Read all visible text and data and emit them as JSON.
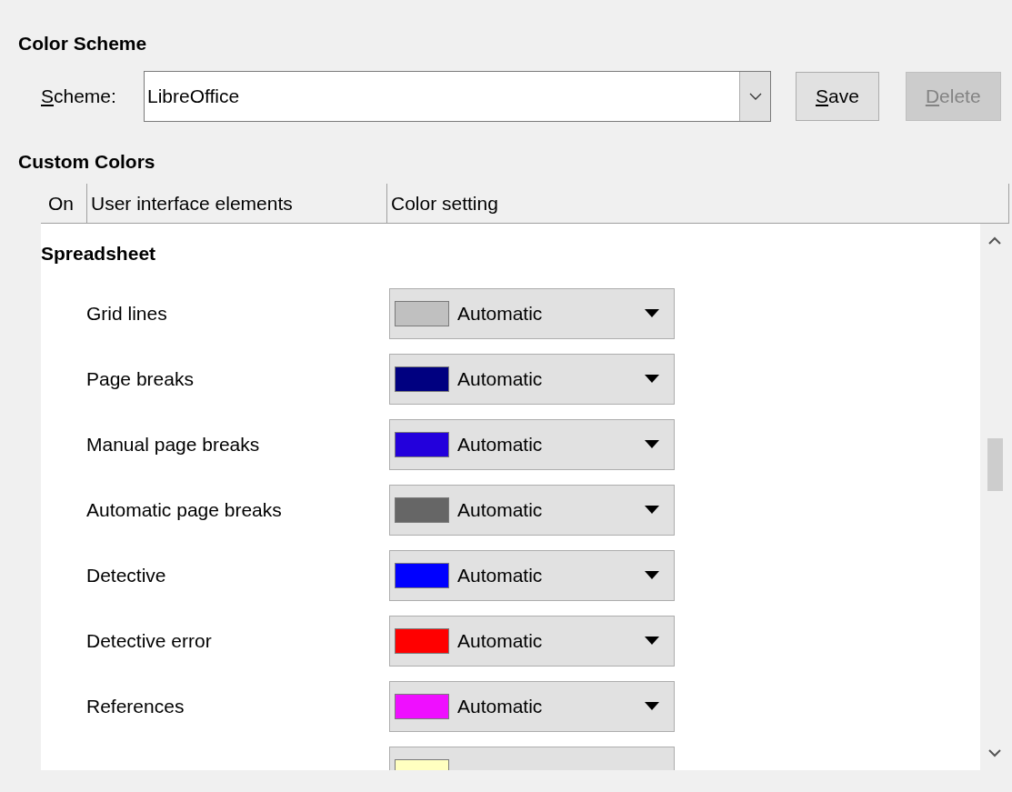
{
  "color_scheme": {
    "title": "Color Scheme",
    "label": {
      "text": "Scheme:",
      "access_key_underlined": true
    },
    "value": "LibreOffice",
    "buttons": [
      {
        "label": "Save",
        "disabled": false,
        "access_key_underlined": true
      },
      {
        "label": "Delete",
        "disabled": true,
        "access_key_underlined": true
      }
    ]
  },
  "custom_colors": {
    "title": "Custom Colors",
    "columns": [
      "On",
      "User interface elements",
      "Color setting"
    ],
    "section": "Spreadsheet",
    "rows": [
      {
        "label": "Grid lines",
        "color": "#c0c0c0",
        "setting": "Automatic"
      },
      {
        "label": "Page breaks",
        "color": "#000080",
        "setting": "Automatic"
      },
      {
        "label": "Manual page breaks",
        "color": "#2300dc",
        "setting": "Automatic"
      },
      {
        "label": "Automatic page breaks",
        "color": "#666666",
        "setting": "Automatic"
      },
      {
        "label": "Detective",
        "color": "#0000ff",
        "setting": "Automatic"
      },
      {
        "label": "Detective error",
        "color": "#ff0000",
        "setting": "Automatic"
      },
      {
        "label": "References",
        "color": "#ef0fff",
        "setting": "Automatic"
      },
      {
        "color": "#ffffc0"
      }
    ]
  }
}
